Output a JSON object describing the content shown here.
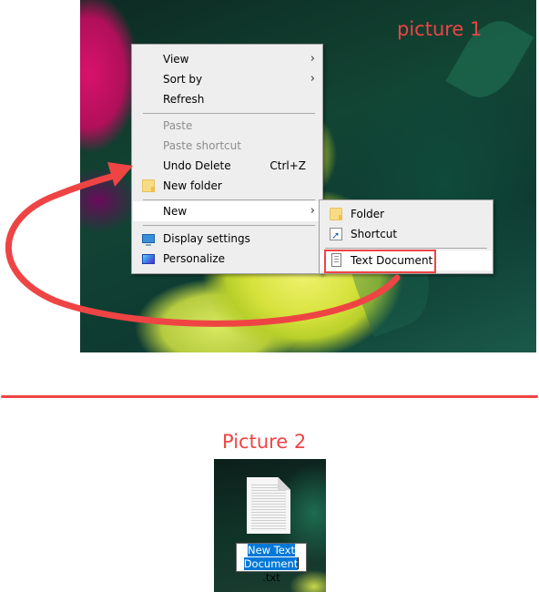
{
  "picture1": {
    "label": "picture 1",
    "context_menu": {
      "items": [
        {
          "label": "View",
          "has_submenu": true,
          "disabled": false
        },
        {
          "label": "Sort by",
          "has_submenu": true,
          "disabled": false
        },
        {
          "label": "Refresh",
          "has_submenu": false,
          "disabled": false
        },
        {
          "label": "Paste",
          "has_submenu": false,
          "disabled": true
        },
        {
          "label": "Paste shortcut",
          "has_submenu": false,
          "disabled": true
        },
        {
          "label": "Undo Delete",
          "shortcut": "Ctrl+Z",
          "has_submenu": false,
          "disabled": false
        },
        {
          "label": "New folder",
          "icon": "folder-icon",
          "has_submenu": false,
          "disabled": false
        },
        {
          "label": "New",
          "has_submenu": true,
          "disabled": false,
          "highlighted": true
        },
        {
          "label": "Display settings",
          "icon": "display-icon",
          "has_submenu": false,
          "disabled": false
        },
        {
          "label": "Personalize",
          "icon": "personalize-icon",
          "has_submenu": false,
          "disabled": false
        }
      ],
      "submenu_arrow": "›"
    },
    "new_submenu": {
      "items": [
        {
          "label": "Folder",
          "icon": "folder-icon"
        },
        {
          "label": "Shortcut",
          "icon": "shortcut-icon"
        },
        {
          "label": "Text Document",
          "icon": "text-document-icon",
          "highlighted": true
        }
      ]
    },
    "annotation_color": "#ef4444"
  },
  "picture2": {
    "label": "Picture 2",
    "file": {
      "icon": "text-document-icon",
      "rename_line1": "New Text",
      "rename_line2_selected": "Document",
      "rename_line2_ext": ".txt"
    }
  },
  "colors": {
    "menu_bg": "#eeeeee",
    "menu_highlight": "#ffffff",
    "selection": "#0078d7",
    "annotation": "#ef4444"
  }
}
